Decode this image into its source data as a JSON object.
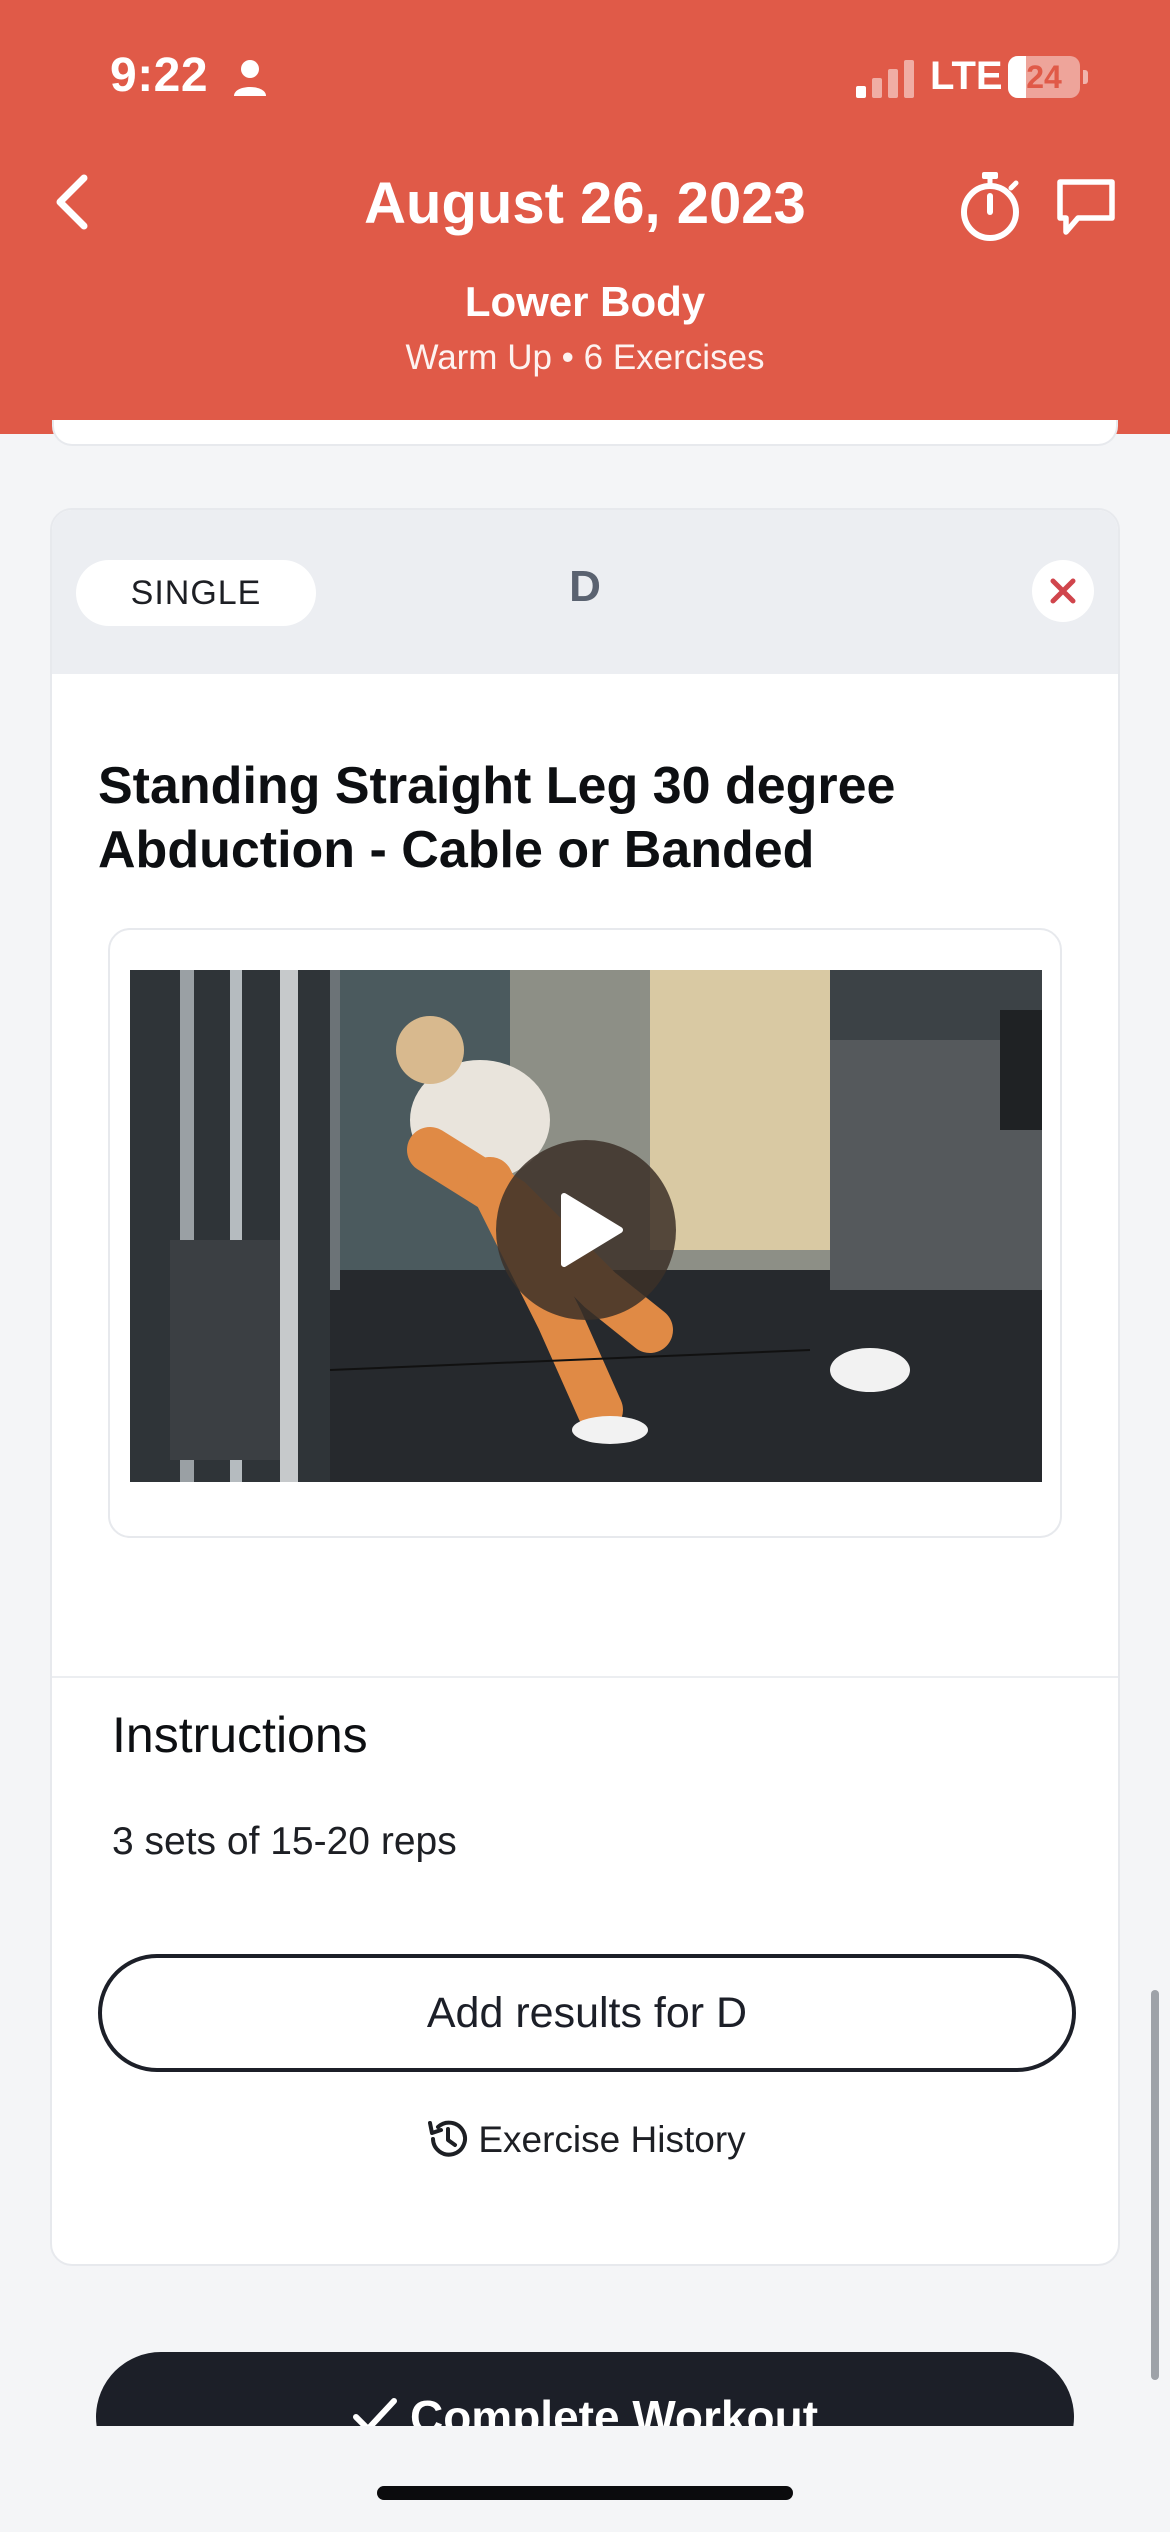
{
  "status_bar": {
    "time": "9:22",
    "network": "LTE",
    "battery": "24",
    "battery_level": 0.24
  },
  "header": {
    "date": "August 26, 2023",
    "workout_name": "Lower Body",
    "subtitle": "Warm Up • 6 Exercises",
    "icons": [
      "chevron-left-icon",
      "stopwatch-icon",
      "chat-icon"
    ],
    "background_color": "#e05a48"
  },
  "exercise_card": {
    "type_label": "SINGLE",
    "letter": "D",
    "title": "Standing Straight Leg 30 degree Abduction - Cable or Banded",
    "instructions_heading": "Instructions",
    "instructions_text": "3 sets of 15-20 reps",
    "add_results_label": "Add results for D",
    "history_label": "Exercise History"
  },
  "footer": {
    "complete_label": "Complete Workout"
  },
  "colors": {
    "accent": "#e05a48",
    "dark_button": "#1c1f28",
    "close_red": "#d0454c"
  }
}
